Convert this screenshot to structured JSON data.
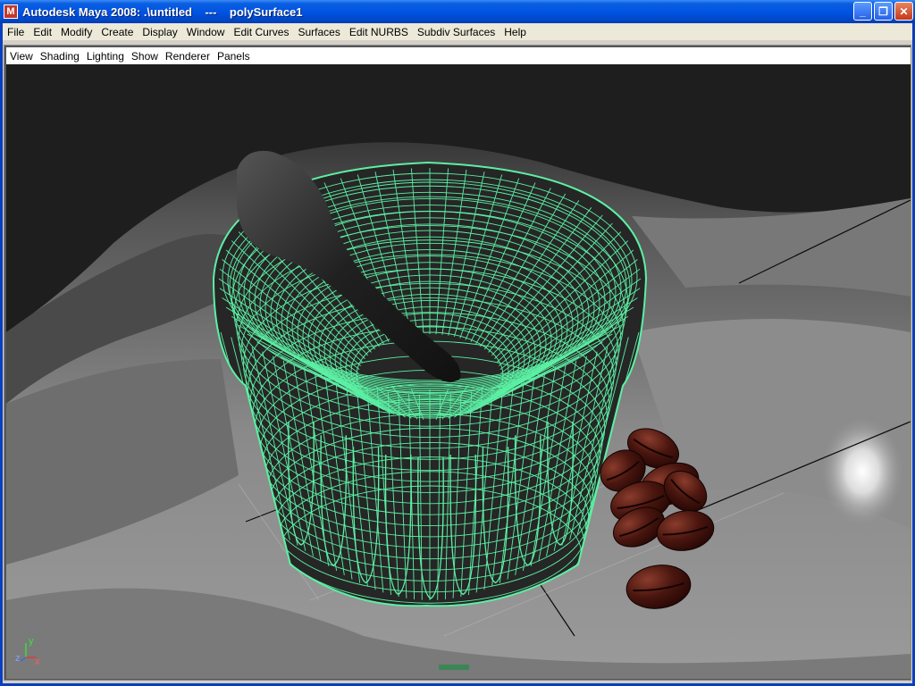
{
  "window": {
    "title": "Autodesk Maya 2008: .\\untitled    ---    polySurface1",
    "icon": "maya-app-icon",
    "buttons": {
      "minimize": "minimize-icon",
      "maximize": "restore-icon",
      "close": "close-icon"
    }
  },
  "menubar": {
    "items": [
      "File",
      "Edit",
      "Modify",
      "Create",
      "Display",
      "Window",
      "Edit Curves",
      "Surfaces",
      "Edit NURBS",
      "Subdiv Surfaces",
      "Help"
    ]
  },
  "panel": {
    "menu": [
      "View",
      "Shading",
      "Lighting",
      "Show",
      "Renderer",
      "Panels"
    ]
  },
  "viewport": {
    "wireframe_color": "#5cf0a4",
    "background_color": "#3b3b3b",
    "axis": {
      "y": "y",
      "z": "z",
      "x": "x"
    }
  }
}
